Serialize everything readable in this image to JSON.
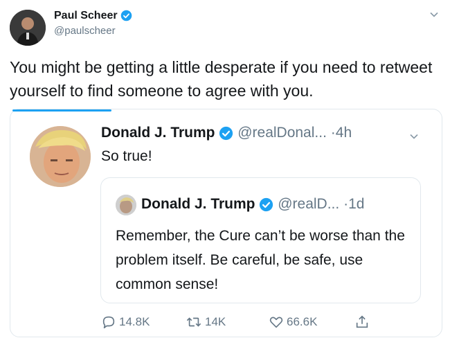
{
  "outer_tweet": {
    "author_name": "Paul Scheer",
    "handle": "@paulscheer",
    "text": "You might be getting a little desperate if you need to retweet yourself to find someone to agree with you."
  },
  "retweet": {
    "author_name": "Donald J. Trump",
    "handle": "@realDonal...",
    "separator": "·",
    "age": "4h",
    "text": "So true!",
    "reply_count": "14.8K",
    "retweet_count": "14K",
    "like_count": "66.6K"
  },
  "quoted_tweet": {
    "author_name": "Donald J. Trump",
    "handle": "@realD...",
    "separator": "·",
    "age": "1d",
    "text": "Remember, the Cure can’t be worse than the problem itself. Be careful, be safe, use common sense!"
  },
  "colors": {
    "brand_blue": "#1da1f2",
    "muted_text": "#657786",
    "border": "#e1e8ed"
  },
  "icons": [
    "verified-badge-icon",
    "chevron-down-icon",
    "reply-icon",
    "retweet-icon",
    "like-icon",
    "share-icon"
  ]
}
